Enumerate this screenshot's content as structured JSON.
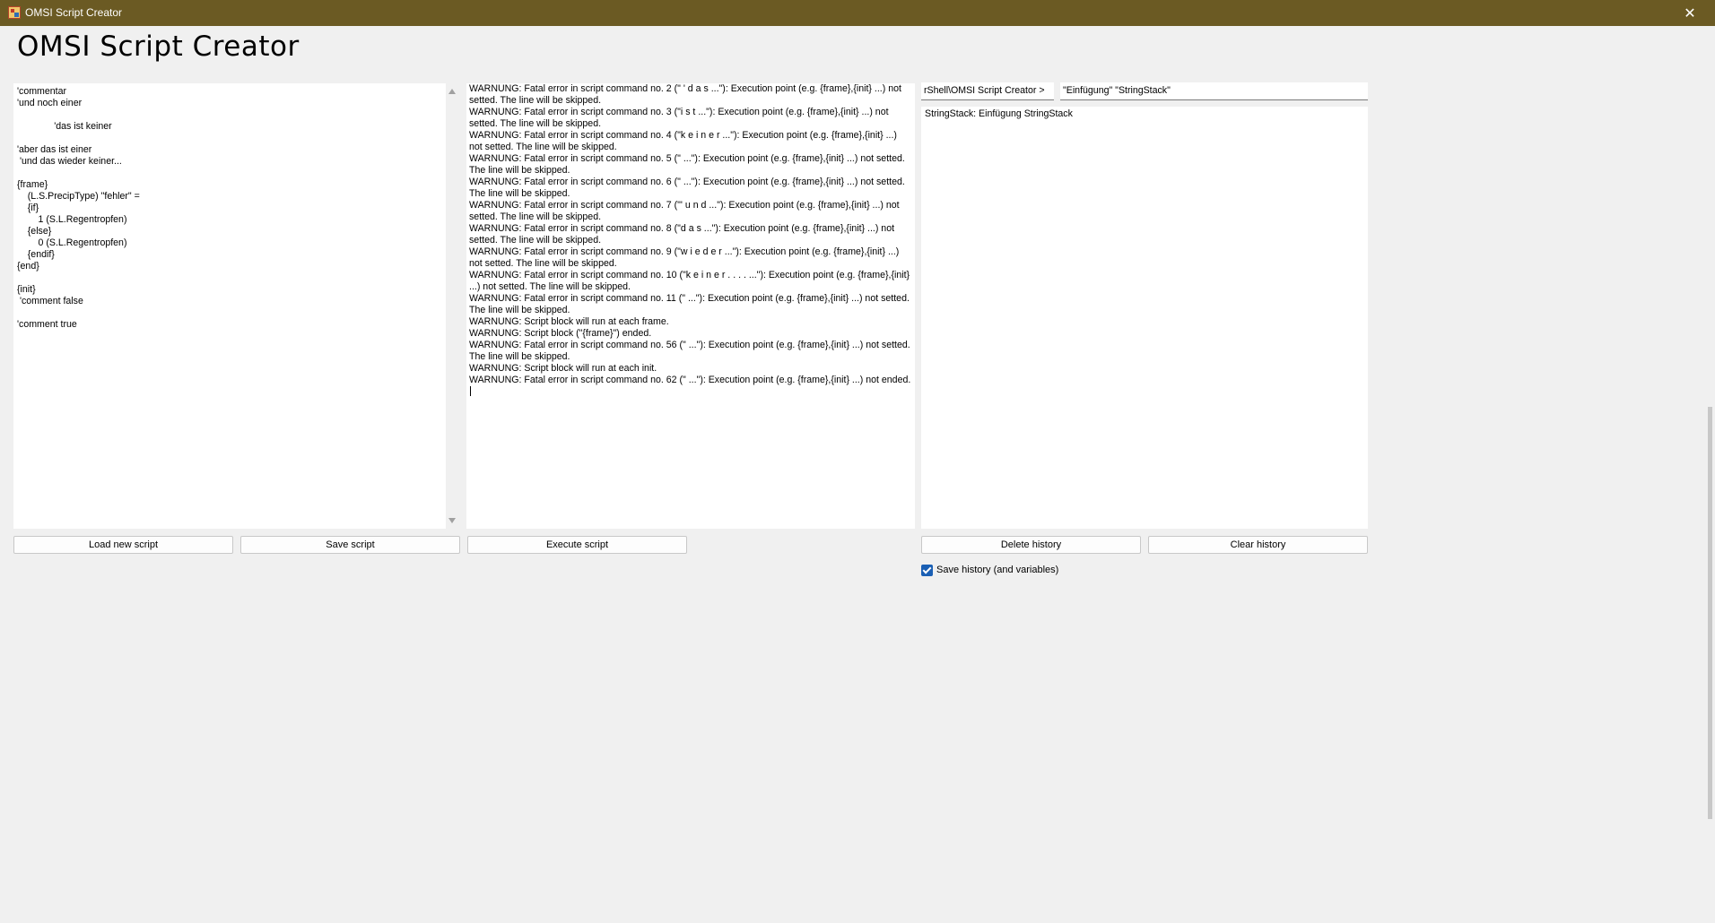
{
  "window": {
    "title": "OMSI Script Creator",
    "close_glyph": "✕"
  },
  "heading": "OMSI Script Creator",
  "script_editor": {
    "lines": [
      "'commentar",
      "'und noch einer",
      "",
      "              'das ist keiner",
      "",
      "'aber das ist einer",
      " 'und das wieder keiner...",
      "",
      "{frame}",
      "    (L.S.PrecipType) \"fehler\" =",
      "    {if}",
      "        1 (S.L.Regentropfen)",
      "    {else}",
      "        0 (S.L.Regentropfen)",
      "    {endif}",
      "{end}",
      "",
      "{init}",
      " 'comment false",
      "",
      "'comment true"
    ]
  },
  "output_log": [
    "WARNUNG: Fatal error in script command no. 2 (\"              ' d a s ...\"): Execution point (e.g. {frame},{init} ...) not setted. The line will be skipped.",
    "WARNUNG: Fatal error in script command no. 3 (\"i s t ...\"): Execution point (e.g. {frame},{init} ...) not setted. The line will be skipped.",
    "WARNUNG: Fatal error in script command no. 4 (\"k e i n e r ...\"): Execution point (e.g. {frame},{init} ...) not setted. The line will be skipped.",
    "WARNUNG: Fatal error in script command no. 5 (\" ...\"): Execution point (e.g. {frame},{init} ...) not setted. The line will be skipped.",
    "WARNUNG: Fatal error in script command no. 6 (\" ...\"): Execution point (e.g. {frame},{init} ...) not setted. The line will be skipped.",
    "WARNUNG: Fatal error in script command no. 7 (\"' u n d ...\"): Execution point (e.g. {frame},{init} ...) not setted. The line will be skipped.",
    "WARNUNG: Fatal error in script command no. 8 (\"d a s ...\"): Execution point (e.g. {frame},{init} ...) not setted. The line will be skipped.",
    "WARNUNG: Fatal error in script command no. 9 (\"w i e d e r ...\"): Execution point (e.g. {frame},{init} ...) not setted. The line will be skipped.",
    "WARNUNG: Fatal error in script command no. 10 (\"k e i n e r . . . . ...\"): Execution point (e.g. {frame},{init} ...) not setted. The line will be skipped.",
    "WARNUNG: Fatal error in script command no. 11 (\" ...\"): Execution point (e.g. {frame},{init} ...) not setted. The line will be skipped.",
    "WARNUNG: Script block will run at each frame.",
    "WARNUNG: Script block (\"{frame}\") ended.",
    "WARNUNG: Fatal error in script command no. 56 (\" ...\"): Execution point (e.g. {frame},{init} ...) not setted. The line will be skipped.",
    "WARNUNG: Script block will run at each init.",
    "WARNUNG: Fatal error in script command no. 62 (\" ...\"): Execution point (e.g. {frame},{init} ...) not ended."
  ],
  "path_label": "rShell\\OMSI Script Creator >",
  "command_input": "\"Einfügung\" \"StringStack\"",
  "history": "StringStack: Einfügung StringStack",
  "buttons": {
    "load": "Load new script",
    "save": "Save script",
    "execute": "Execute script",
    "delete_history": "Delete history",
    "clear_history": "Clear history"
  },
  "save_history_checkbox": {
    "label": "Save history (and variables)",
    "checked": true
  },
  "colors": {
    "titlebar": "#6b5a23",
    "window_bg": "#f0f0f0",
    "checkbox_accent": "#1a5fb4"
  }
}
